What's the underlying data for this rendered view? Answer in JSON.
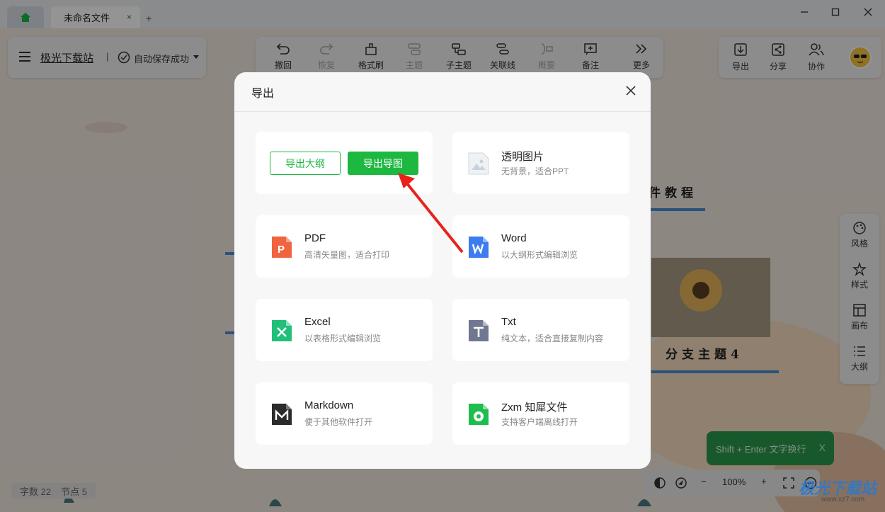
{
  "window": {
    "tab_title": "未命名文件",
    "tab_close": "×",
    "new_tab": "+",
    "controls": {
      "minimize": "—",
      "maximize": "☐",
      "close": "✕"
    }
  },
  "header": {
    "brand": "极光下载站",
    "divider": "|",
    "save_status": "自动保存成功"
  },
  "toolbar": {
    "items": [
      {
        "label": "撤回",
        "icon": "undo-icon"
      },
      {
        "label": "恢复",
        "icon": "redo-icon"
      },
      {
        "label": "格式刷",
        "icon": "format-brush-icon"
      },
      {
        "label": "主题",
        "icon": "topic-icon"
      },
      {
        "label": "子主题",
        "icon": "subtopic-icon"
      },
      {
        "label": "关联线",
        "icon": "relation-line-icon"
      },
      {
        "label": "概要",
        "icon": "summary-icon"
      },
      {
        "label": "备注",
        "icon": "note-icon"
      },
      {
        "label": "更多",
        "icon": "more-icon"
      }
    ]
  },
  "right_toolbar": {
    "export": "导出",
    "share": "分享",
    "collab": "协作"
  },
  "side_panel": {
    "items": [
      {
        "label": "风格",
        "icon": "palette-icon"
      },
      {
        "label": "样式",
        "icon": "style-icon"
      },
      {
        "label": "画布",
        "icon": "canvas-icon"
      },
      {
        "label": "大纲",
        "icon": "outline-icon"
      }
    ]
  },
  "canvas": {
    "node_top": "件教程",
    "node_bottom": "分支主题4"
  },
  "dialog": {
    "title": "导出",
    "outline_btn": "导出大纲",
    "mindmap_btn": "导出导图",
    "options": [
      {
        "title": "透明图片",
        "sub": "无背景，适合PPT",
        "icon": "image-file-icon",
        "color": "#e8eef2"
      },
      {
        "title": "PDF",
        "sub": "高清矢量图，适合打印",
        "icon": "pdf-file-icon",
        "color": "#f0643f"
      },
      {
        "title": "Word",
        "sub": "以大纲形式编辑浏览",
        "icon": "word-file-icon",
        "color": "#3c7cf0"
      },
      {
        "title": "Excel",
        "sub": "以表格形式编辑浏览",
        "icon": "excel-file-icon",
        "color": "#22bf7a"
      },
      {
        "title": "Txt",
        "sub": "纯文本，适合直接复制内容",
        "icon": "txt-file-icon",
        "color": "#6f7890"
      },
      {
        "title": "Markdown",
        "sub": "便于其他软件打开",
        "icon": "markdown-file-icon",
        "color": "#2b2b2b"
      },
      {
        "title": "Zxm 知犀文件",
        "sub": "支持客户端离线打开",
        "icon": "zxm-file-icon",
        "color": "#1ebd4e"
      }
    ]
  },
  "toast": {
    "text": "Shift + Enter 文字换行",
    "close": "X"
  },
  "bottom": {
    "zoom": "100%",
    "minus": "−",
    "plus": "+",
    "word_count": "字数 22",
    "node_count": "节点 5"
  },
  "watermark": {
    "main": "极光下载站",
    "sub": "www.xz7.com"
  },
  "colors": {
    "accent": "#1db83f",
    "overlay": "rgba(0,0,0,0.42)"
  }
}
